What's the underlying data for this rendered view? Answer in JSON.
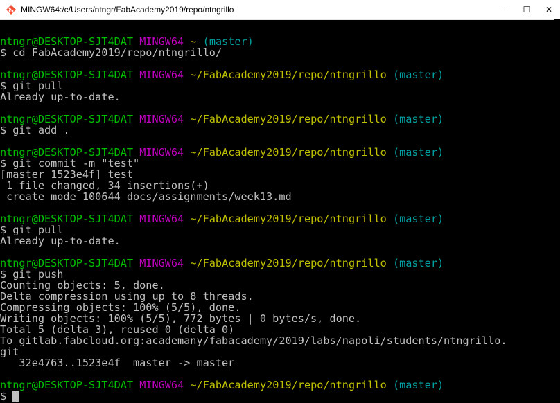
{
  "window": {
    "title": "MINGW64:/c/Users/ntngr/FabAcademy2019/repo/ntngrillo",
    "icon": "mingw-icon",
    "controls": {
      "minimize": "—",
      "maximize": "☐",
      "close": "✕"
    }
  },
  "terminal": {
    "prompt_user": "ntngr@DESKTOP-SJT4DAT",
    "prompt_env": "MINGW64",
    "lines": [
      {
        "type": "blank"
      },
      {
        "type": "prompt",
        "path": "~",
        "branch": "(master)"
      },
      {
        "type": "text",
        "text": "$ cd FabAcademy2019/repo/ntngrillo/"
      },
      {
        "type": "blank"
      },
      {
        "type": "prompt",
        "path": "~/FabAcademy2019/repo/ntngrillo",
        "branch": "(master)"
      },
      {
        "type": "text",
        "text": "$ git pull"
      },
      {
        "type": "text",
        "text": "Already up-to-date."
      },
      {
        "type": "blank"
      },
      {
        "type": "prompt",
        "path": "~/FabAcademy2019/repo/ntngrillo",
        "branch": "(master)"
      },
      {
        "type": "text",
        "text": "$ git add ."
      },
      {
        "type": "blank"
      },
      {
        "type": "prompt",
        "path": "~/FabAcademy2019/repo/ntngrillo",
        "branch": "(master)"
      },
      {
        "type": "text",
        "text": "$ git commit -m \"test\""
      },
      {
        "type": "text",
        "text": "[master 1523e4f] test"
      },
      {
        "type": "text",
        "text": " 1 file changed, 34 insertions(+)"
      },
      {
        "type": "text",
        "text": " create mode 100644 docs/assignments/week13.md"
      },
      {
        "type": "blank"
      },
      {
        "type": "prompt",
        "path": "~/FabAcademy2019/repo/ntngrillo",
        "branch": "(master)"
      },
      {
        "type": "text",
        "text": "$ git pull"
      },
      {
        "type": "text",
        "text": "Already up-to-date."
      },
      {
        "type": "blank"
      },
      {
        "type": "prompt",
        "path": "~/FabAcademy2019/repo/ntngrillo",
        "branch": "(master)"
      },
      {
        "type": "text",
        "text": "$ git push"
      },
      {
        "type": "text",
        "text": "Counting objects: 5, done."
      },
      {
        "type": "text",
        "text": "Delta compression using up to 8 threads."
      },
      {
        "type": "text",
        "text": "Compressing objects: 100% (5/5), done."
      },
      {
        "type": "text",
        "text": "Writing objects: 100% (5/5), 772 bytes | 0 bytes/s, done."
      },
      {
        "type": "text",
        "text": "Total 5 (delta 3), reused 0 (delta 0)"
      },
      {
        "type": "text",
        "text": "To gitlab.fabcloud.org:academany/fabacademy/2019/labs/napoli/students/ntngrillo."
      },
      {
        "type": "text",
        "text": "git"
      },
      {
        "type": "text",
        "text": "   32e4763..1523e4f  master -> master"
      },
      {
        "type": "blank"
      },
      {
        "type": "prompt",
        "path": "~/FabAcademy2019/repo/ntngrillo",
        "branch": "(master)"
      },
      {
        "type": "input",
        "text": "$ "
      }
    ]
  },
  "colors": {
    "background": "#000000",
    "text": "#c0c0c0",
    "user": "#00c000",
    "env": "#c000c0",
    "path": "#c0c000",
    "branch": "#00a0a0"
  }
}
